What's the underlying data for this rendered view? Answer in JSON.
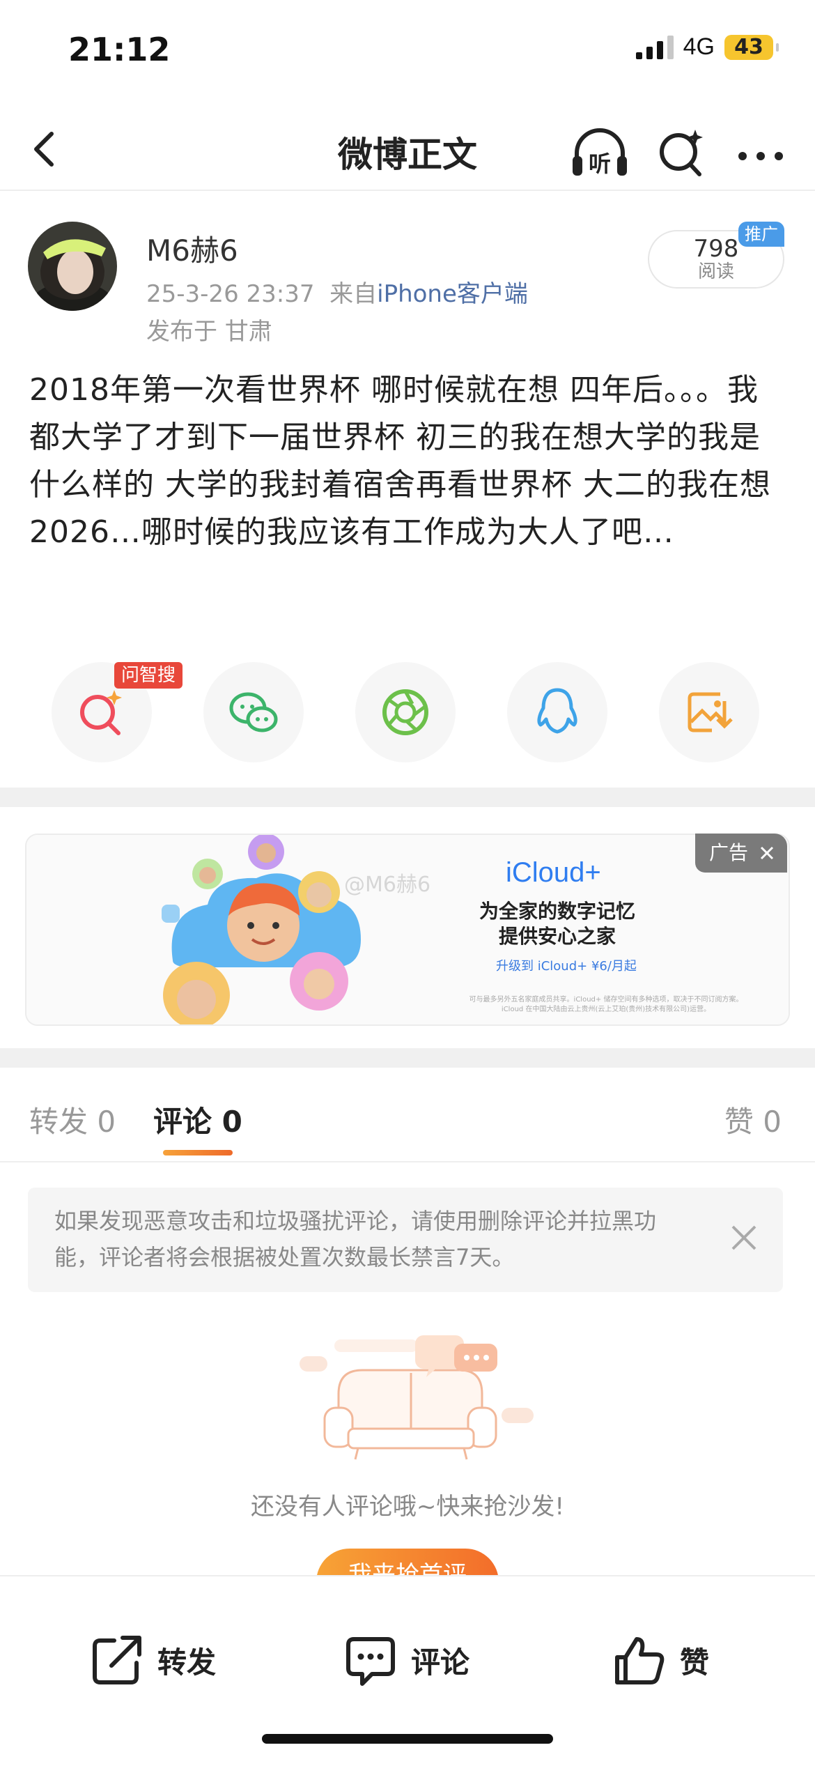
{
  "status_bar": {
    "time": "21:12",
    "network": "4G",
    "battery": "43"
  },
  "nav": {
    "title": "微博正文",
    "listen_label": "听"
  },
  "post": {
    "author": "M6赫6",
    "time": "25-3-26 23:37",
    "source_prefix": "来自",
    "source": "iPhone客户端",
    "region": "发布于 甘肃",
    "read_count": "798",
    "read_label": "阅读",
    "promo_tag": "推广",
    "text": "2018年第一次看世界杯 哪时候就在想 四年后。。。我都大学了才到下一届世界杯 初三的我在想大学的我是什么样的 大学的我封着宿舍再看世界杯 大二的我在想2026…哪时候的我应该有工作成为大人了吧…"
  },
  "share": {
    "zhisou_tag": "问智搜"
  },
  "ad": {
    "label": "广告",
    "watermark": "@M6赫6",
    "brand": "iCloud+",
    "title_line1": "为全家的数字记忆",
    "title_line2": "提供安心之家",
    "cta": "升级到 iCloud+ ¥6/月起",
    "fine_print_1": "可与最多另外五名家庭成员共享。iCloud+ 储存空间有多种选项，取决于不同订阅方案。",
    "fine_print_2": "iCloud 在中国大陆由云上贵州(云上艾珀(贵州)技术有限公司)运营。"
  },
  "tabs": {
    "repost": "转发 0",
    "comment": "评论 0",
    "like": "赞 0"
  },
  "notice": {
    "text": "如果发现恶意攻击和垃圾骚扰评论，请使用删除评论并拉黑功能，评论者将会根据被处置次数最长禁言7天。"
  },
  "empty": {
    "text": "还没有人评论哦~快来抢沙发!",
    "button": "我来抢首评"
  },
  "bottom_bar": {
    "repost": "转发",
    "comment": "评论",
    "like": "赞"
  },
  "colors": {
    "accent": "#f36d2a",
    "link": "#4f6fa6",
    "promo": "#4a9be8"
  }
}
